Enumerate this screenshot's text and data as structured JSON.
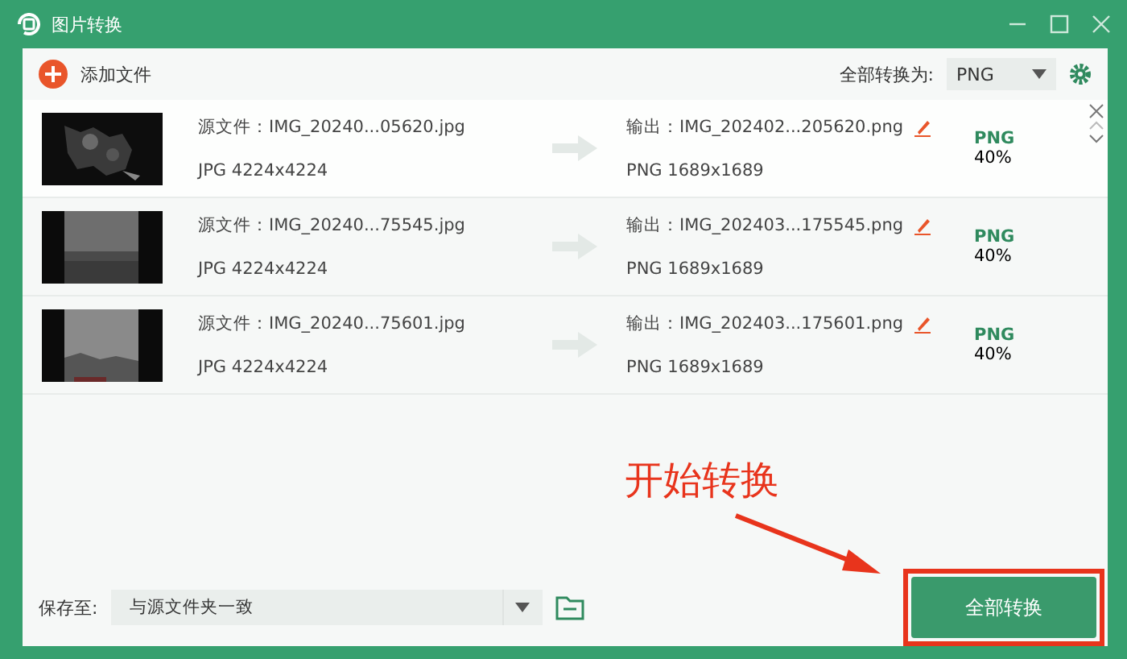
{
  "window": {
    "title": "图片转换"
  },
  "toolbar": {
    "add_button": "添加文件",
    "convert_all_label": "全部转换为:",
    "format": "PNG"
  },
  "files": [
    {
      "source": "源文件：IMG_20240...05620.jpg",
      "source_info": "JPG  4224x4224",
      "output": "输出：IMG_202402...205620.png",
      "output_info": "PNG  1689x1689",
      "format": "PNG",
      "quality": "40%",
      "hovered": true
    },
    {
      "source": "源文件：IMG_20240...75545.jpg",
      "source_info": "JPG  4224x4224",
      "output": "输出：IMG_202403...175545.png",
      "output_info": "PNG  1689x1689",
      "format": "PNG",
      "quality": "40%",
      "hovered": false
    },
    {
      "source": "源文件：IMG_20240...75601.jpg",
      "source_info": "JPG  4224x4224",
      "output": "输出：IMG_202403...175601.png",
      "output_info": "PNG  1689x1689",
      "format": "PNG",
      "quality": "40%",
      "hovered": false
    }
  ],
  "footer": {
    "save_label": "保存至:",
    "save_location": "与源文件夹一致",
    "convert_button": "全部转换"
  },
  "annotation": {
    "text": "开始转换"
  }
}
